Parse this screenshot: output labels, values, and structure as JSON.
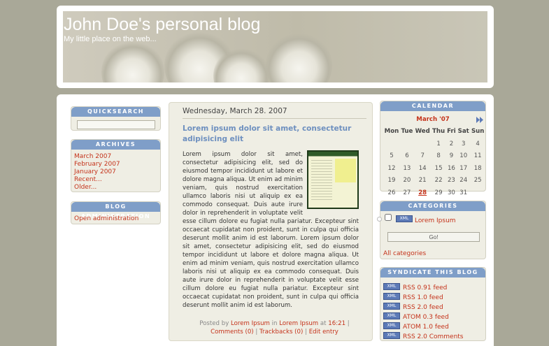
{
  "header": {
    "title": "John Doe's personal blog",
    "description": "My little place on the web..."
  },
  "sidebar_left": {
    "quicksearch": {
      "title": "QUICKSEARCH",
      "value": ""
    },
    "archives": {
      "title": "ARCHIVES",
      "items": [
        "March 2007",
        "February 2007",
        "January 2007",
        "Recent...",
        "Older..."
      ]
    },
    "admin": {
      "title": "BLOG ADMINISTRATION",
      "link": "Open administration"
    }
  },
  "post": {
    "date": "Wednesday, March 28. 2007",
    "title": "Lorem ipsum dolor sit amet, consectetur adipisicing elit",
    "body": "Lorem ipsum dolor sit amet, consectetur adipisicing elit, sed do eiusmod tempor incididunt ut labore et dolore magna aliqua. Ut enim ad minim veniam, quis nostrud exercitation ullamco laboris nisi ut aliquip ex ea commodo consequat. Duis aute irure dolor in reprehenderit in voluptate velit esse cillum dolore eu fugiat nulla pariatur. Excepteur sint occaecat cupidatat non proident, sunt in culpa qui officia deserunt mollit anim id est laborum. Lorem ipsum dolor sit amet, consectetur adipisicing elit, sed do eiusmod tempor incididunt ut labore et dolore magna aliqua. Ut enim ad minim veniam, quis nostrud exercitation ullamco laboris nisi ut aliquip ex ea commodo consequat. Duis aute irure dolor in reprehenderit in voluptate velit esse cillum dolore eu fugiat nulla pariatur. Excepteur sint occaecat cupidatat non proident, sunt in culpa qui officia deserunt mollit anim id est laborum.",
    "meta": {
      "posted_by": "Posted by",
      "author": "Lorem Ipsum",
      "in": "in",
      "category": "Lorem Ipsum",
      "at": "at",
      "time": "16:21",
      "sep": "|",
      "comments": "Comments (0)",
      "trackbacks": "Trackbacks (0)",
      "edit": "Edit entry"
    }
  },
  "sidebar_right": {
    "calendar": {
      "title": "CALENDAR",
      "month": "March '07",
      "next_icon": "double-chevron-right-icon",
      "days": [
        "Mon",
        "Tue",
        "Wed",
        "Thu",
        "Fri",
        "Sat",
        "Sun"
      ],
      "weeks": [
        [
          "",
          "",
          "",
          "1",
          "2",
          "3",
          "4"
        ],
        [
          "5",
          "6",
          "7",
          "8",
          "9",
          "10",
          "11"
        ],
        [
          "12",
          "13",
          "14",
          "15",
          "16",
          "17",
          "18"
        ],
        [
          "19",
          "20",
          "21",
          "22",
          "23",
          "24",
          "25"
        ],
        [
          "26",
          "27",
          "28",
          "29",
          "30",
          "31",
          ""
        ]
      ],
      "highlight": "28"
    },
    "categories": {
      "title": "CATEGORIES",
      "xml_label": "XML",
      "item": "Lorem Ipsum",
      "go_label": "Go!",
      "all_label": "All categories"
    },
    "syndicate": {
      "title": "SYNDICATE THIS BLOG",
      "xml_label": "XML",
      "feeds": [
        "RSS 0.91 feed",
        "RSS 1.0 feed",
        "RSS 2.0 feed",
        "ATOM 0.3 feed",
        "ATOM 1.0 feed",
        "RSS 2.0 Comments"
      ]
    }
  },
  "colors": {
    "background": "#a9a898",
    "box_header": "#7f9ec8",
    "link": "#c4321a",
    "post_title": "#6d8fbf"
  }
}
